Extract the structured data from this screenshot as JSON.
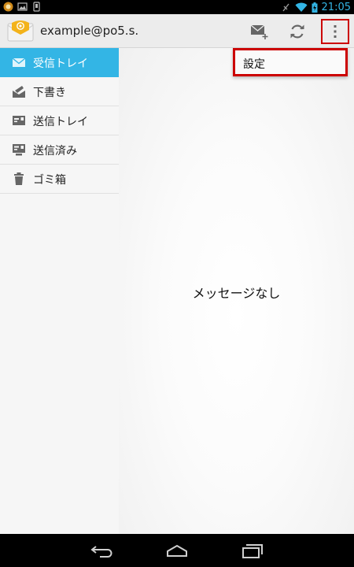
{
  "status_bar": {
    "time": "21:05",
    "left_icons": [
      "notification-app-icon",
      "gallery-icon",
      "device-icon"
    ],
    "right_icons": [
      "vibrate-icon",
      "wifi-icon",
      "battery-icon"
    ]
  },
  "action_bar": {
    "account": "example@po5.s.",
    "icons": [
      "mail-app-icon",
      "compose-icon",
      "refresh-icon",
      "overflow-menu-icon"
    ]
  },
  "menu": {
    "items": [
      {
        "label": "設定"
      }
    ]
  },
  "folders": [
    {
      "label": "受信トレイ",
      "icon": "inbox-icon",
      "active": true
    },
    {
      "label": "下書き",
      "icon": "drafts-icon",
      "active": false
    },
    {
      "label": "送信トレイ",
      "icon": "outbox-icon",
      "active": false
    },
    {
      "label": "送信済み",
      "icon": "sent-icon",
      "active": false
    },
    {
      "label": "ゴミ箱",
      "icon": "trash-icon",
      "active": false
    }
  ],
  "content": {
    "empty_message": "メッセージなし"
  },
  "nav_bar": {
    "icons": [
      "back-icon",
      "home-icon",
      "recent-apps-icon"
    ]
  },
  "colors": {
    "accent": "#33b5e5",
    "highlight_border": "#cc0000",
    "status_bar": "#000000",
    "action_bar": "#ececec"
  }
}
